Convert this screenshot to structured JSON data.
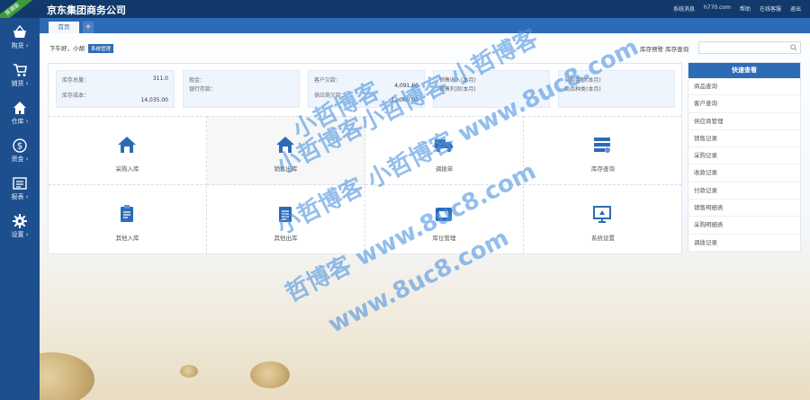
{
  "header": {
    "corner_ribbon": "普通版",
    "company": "京东集团商务公司",
    "links": [
      "系统消息",
      "h770.com",
      "帮助",
      "在线客服",
      "退出"
    ]
  },
  "sidebar": {
    "items": [
      {
        "label": "购货",
        "icon": "basket-icon"
      },
      {
        "label": "销货",
        "icon": "cart-icon"
      },
      {
        "label": "仓库",
        "icon": "home-icon"
      },
      {
        "label": "资金",
        "icon": "dollar-icon"
      },
      {
        "label": "报表",
        "icon": "report-icon"
      },
      {
        "label": "设置",
        "icon": "gear-icon"
      }
    ]
  },
  "tabs": {
    "home": "首页",
    "add": "+"
  },
  "greeting": {
    "text": "下午好，小胡",
    "badge": "系统管理"
  },
  "stock_query": {
    "label": "库存预警  库存查询",
    "placeholder": ""
  },
  "stats": [
    {
      "lines": [
        {
          "k": "库存总量：",
          "v": "311.0"
        },
        {
          "k": "库存成本：",
          "v": "14,035.00"
        }
      ]
    },
    {
      "lines": [
        {
          "k": "现金：",
          "v": ""
        },
        {
          "k": "银行存款：",
          "v": ""
        }
      ]
    },
    {
      "lines": [
        {
          "k": "客户欠款：",
          "v": "4,091.60"
        },
        {
          "k": "供应商欠款：",
          "v": "12,060.00"
        }
      ]
    },
    {
      "lines": [
        {
          "k": "销售收入(本月)",
          "v": ""
        },
        {
          "k": "销售利润(本月)",
          "v": ""
        }
      ]
    },
    {
      "lines": [
        {
          "k": "采购金额(本月)",
          "v": ""
        },
        {
          "k": "商品种类(本月)",
          "v": ""
        }
      ]
    }
  ],
  "grid": [
    {
      "label": "采购入库",
      "icon": "purchase-in-icon"
    },
    {
      "label": "销售出库",
      "icon": "sales-out-icon"
    },
    {
      "label": "调拨单",
      "icon": "truck-icon"
    },
    {
      "label": "库存查询",
      "icon": "inventory-icon"
    },
    {
      "label": "其他入库",
      "icon": "other-in-icon"
    },
    {
      "label": "其他出库",
      "icon": "other-out-icon"
    },
    {
      "label": "库位管理",
      "icon": "location-icon"
    },
    {
      "label": "系统设置",
      "icon": "monitor-icon"
    }
  ],
  "quick": {
    "title": "快速查看",
    "items": [
      "商品查询",
      "客户查询",
      "供应商管理",
      "销售记录",
      "采购记录",
      "收款记录",
      "付款记录",
      "销售明细表",
      "采购明细表",
      "调拨记录"
    ]
  },
  "watermark": {
    "lines": [
      "小哲博客",
      "小哲博客小哲博客 小哲博客",
      "小哲博客 小哲博客 www.8uc8.com",
      "哲博客 www.8uc8.com",
      "www.8uc8.com"
    ]
  },
  "colors": {
    "topbar": "#12396b",
    "sidebar": "#1d4f8e",
    "accent": "#2d6bb6",
    "ribbon": "#3e9a38"
  }
}
